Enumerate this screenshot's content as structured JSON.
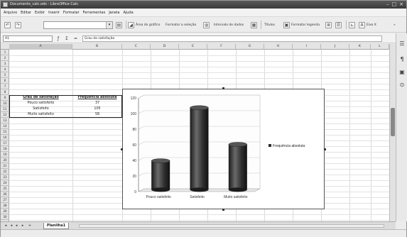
{
  "window": {
    "title": "Documento_calc.ods - LibreOffice Calc",
    "controls": [
      "–",
      "□",
      "×"
    ]
  },
  "menu": [
    "Arquivo",
    "Editar",
    "Exibir",
    "Inserir",
    "Formatar",
    "Ferramentas",
    "Janela",
    "Ajuda"
  ],
  "toolbar": {
    "area_do_grafico": "Área do gráfico",
    "formatar_selecao": "Formatar a seleção",
    "intervalo_de_dados": "Intervalo de dados",
    "titulos": "Títulos",
    "formatar_legenda": "Formatar legenda",
    "eixo": "Eixo X"
  },
  "formula_bar": {
    "name_box": "A1",
    "formula": "Grau de satisfação"
  },
  "columns": [
    "A",
    "B",
    "C",
    "D",
    "E",
    "F",
    "G",
    "H",
    "I",
    "J",
    "K",
    "L"
  ],
  "table": {
    "headers": [
      "Grau de satisfação",
      "Frequência absoluta"
    ],
    "rows": [
      {
        "label": "Pouco satisfeito",
        "value": "37"
      },
      {
        "label": "Satisfeito",
        "value": "105"
      },
      {
        "label": "Muito satisfeito",
        "value": "58"
      }
    ]
  },
  "chart_data": {
    "type": "bar",
    "categories": [
      "Pouco satisfeito",
      "Satisfeito",
      "Muito satisfeito"
    ],
    "series": [
      {
        "name": "Frequência absoluta",
        "values": [
          37,
          105,
          58
        ]
      }
    ],
    "ylim": [
      0,
      120
    ],
    "yticks": [
      0,
      20,
      40,
      60,
      80,
      100,
      120
    ],
    "grid": true,
    "legend": "right",
    "bar_color": "#2f2f2f",
    "style": "3D cylinders"
  },
  "sheet_tabs": [
    "Planilha1"
  ],
  "colors": {
    "titlebar": "#3f3f3f",
    "bar": "#2f2f2f",
    "selected_header": "#c9c9c9"
  }
}
